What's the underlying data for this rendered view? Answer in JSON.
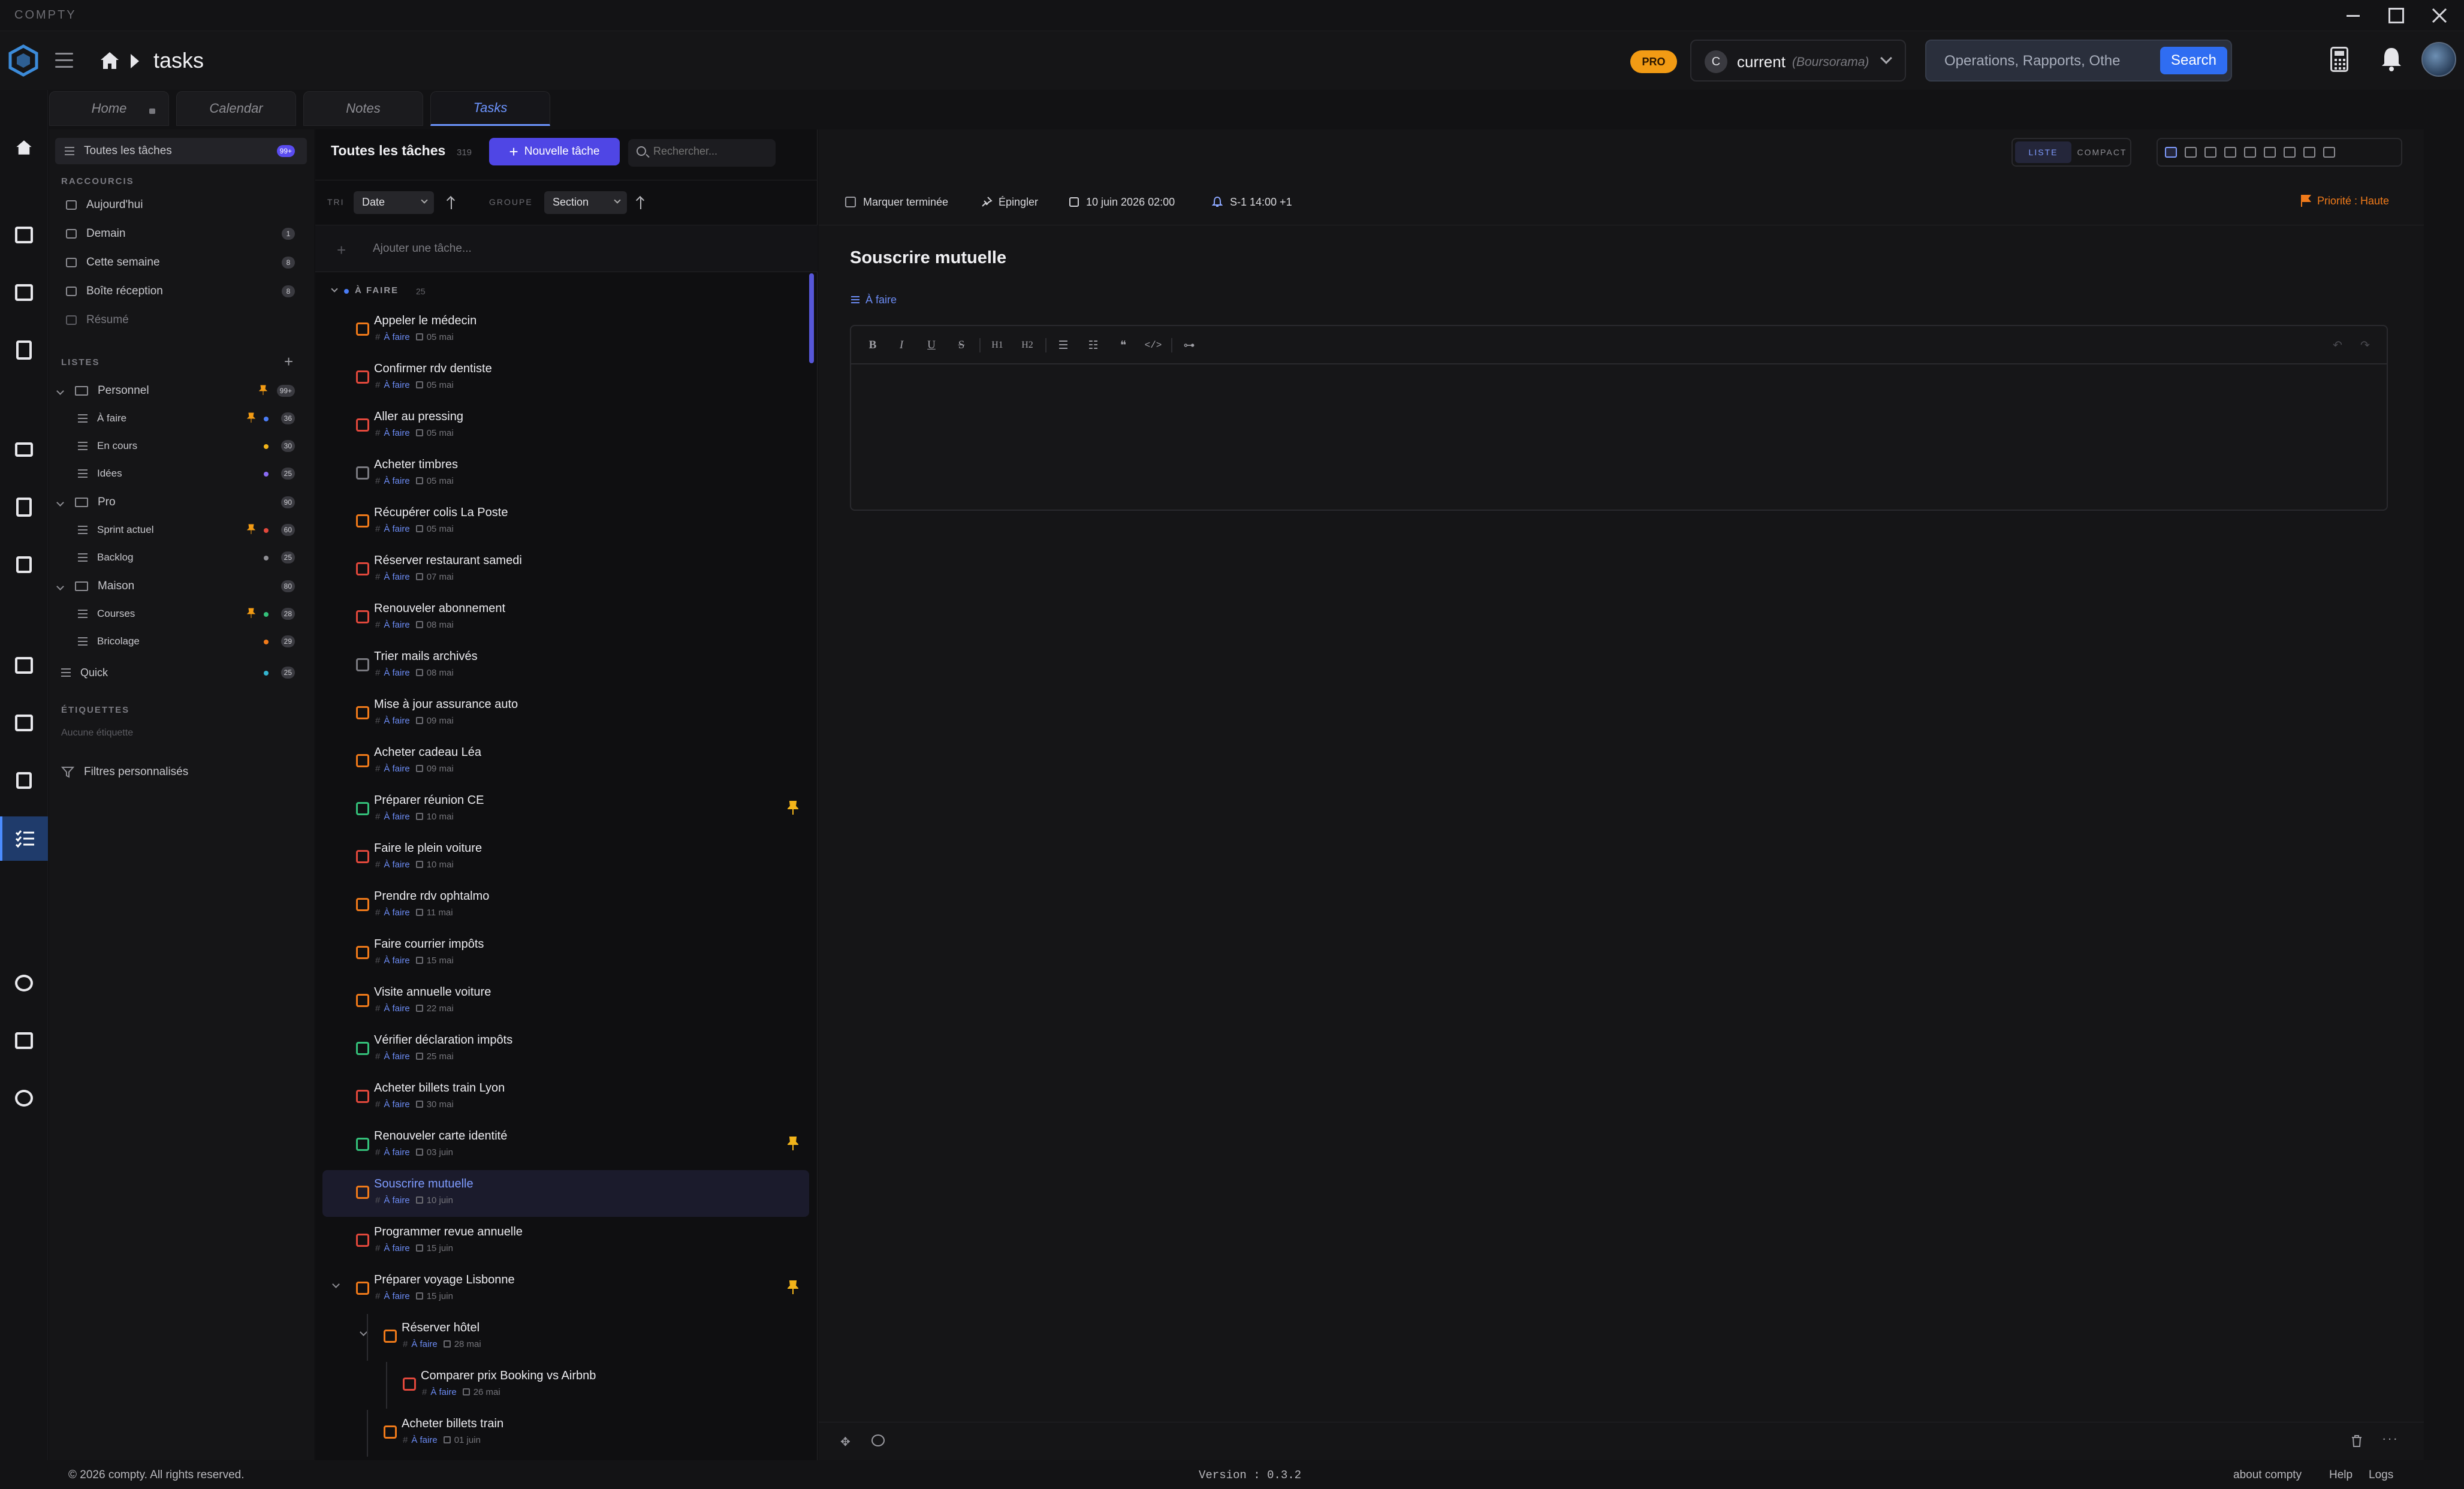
{
  "app": {
    "name": "COMPTY",
    "page_title": "tasks",
    "pro_label": "PRO"
  },
  "account": {
    "avatar_letter": "C",
    "name": "current",
    "bank": "(Boursorama)"
  },
  "search": {
    "placeholder": "Operations, Rapports, Othe",
    "button": "Search"
  },
  "tabs": [
    {
      "label": "Home"
    },
    {
      "label": "Calendar"
    },
    {
      "label": "Notes"
    },
    {
      "label": "Tasks"
    }
  ],
  "sidebar": {
    "all_tasks": {
      "label": "Toutes les tâches",
      "count": "99+"
    },
    "shortcuts_heading": "RACCOURCIS",
    "shortcuts": [
      {
        "label": "Aujourd'hui"
      },
      {
        "label": "Demain",
        "count": "1"
      },
      {
        "label": "Cette semaine",
        "count": "8"
      },
      {
        "label": "Boîte réception",
        "count": "8"
      },
      {
        "label": "Résumé"
      }
    ],
    "lists_heading": "LISTES",
    "folders": [
      {
        "label": "Personnel",
        "count": "99+",
        "lists": [
          {
            "label": "À faire",
            "count": "36"
          },
          {
            "label": "En cours",
            "count": "30"
          },
          {
            "label": "Idées",
            "count": "25"
          }
        ]
      },
      {
        "label": "Pro",
        "count": "90",
        "lists": [
          {
            "label": "Sprint actuel",
            "count": "60"
          },
          {
            "label": "Backlog",
            "count": "25"
          }
        ]
      },
      {
        "label": "Maison",
        "count": "80",
        "lists": [
          {
            "label": "Courses",
            "count": "28"
          },
          {
            "label": "Bricolage",
            "count": "29"
          }
        ]
      }
    ],
    "quick": {
      "label": "Quick",
      "count": "25"
    },
    "tags_heading": "ÉTIQUETTES",
    "no_tags": "Aucune étiquette",
    "custom_filters": "Filtres personnalisés"
  },
  "list": {
    "title": "Toutes les tâches",
    "count": "319",
    "new_button": "Nouvelle tâche",
    "search_placeholder": "Rechercher...",
    "sort_label": "TRI",
    "sort_value": "Date",
    "group_label": "GROUPE",
    "group_value": "Section",
    "add_placeholder": "Ajouter une tâche...",
    "group_heading": "À FAIRE",
    "group_count": "25",
    "tasks": [
      {
        "title": "Appeler le médecin",
        "list": "À faire",
        "date": "05 mai"
      },
      {
        "title": "Confirmer rdv dentiste",
        "list": "À faire",
        "date": "05 mai"
      },
      {
        "title": "Aller au pressing",
        "list": "À faire",
        "date": "05 mai"
      },
      {
        "title": "Acheter timbres",
        "list": "À faire",
        "date": "05 mai"
      },
      {
        "title": "Récupérer colis La Poste",
        "list": "À faire",
        "date": "05 mai"
      },
      {
        "title": "Réserver restaurant samedi",
        "list": "À faire",
        "date": "07 mai"
      },
      {
        "title": "Renouveler abonnement",
        "list": "À faire",
        "date": "08 mai"
      },
      {
        "title": "Trier mails archivés",
        "list": "À faire",
        "date": "08 mai"
      },
      {
        "title": "Mise à jour assurance auto",
        "list": "À faire",
        "date": "09 mai"
      },
      {
        "title": "Acheter cadeau Léa",
        "list": "À faire",
        "date": "09 mai"
      },
      {
        "title": "Préparer réunion CE",
        "list": "À faire",
        "date": "10 mai"
      },
      {
        "title": "Faire le plein voiture",
        "list": "À faire",
        "date": "10 mai"
      },
      {
        "title": "Prendre rdv ophtalmo",
        "list": "À faire",
        "date": "11 mai"
      },
      {
        "title": "Faire courrier impôts",
        "list": "À faire",
        "date": "15 mai"
      },
      {
        "title": "Visite annuelle voiture",
        "list": "À faire",
        "date": "22 mai"
      },
      {
        "title": "Vérifier déclaration impôts",
        "list": "À faire",
        "date": "25 mai"
      },
      {
        "title": "Acheter billets train Lyon",
        "list": "À faire",
        "date": "30 mai"
      },
      {
        "title": "Renouveler carte identité",
        "list": "À faire",
        "date": "03 juin"
      },
      {
        "title": "Souscrire mutuelle",
        "list": "À faire",
        "date": "10 juin"
      },
      {
        "title": "Programmer revue annuelle",
        "list": "À faire",
        "date": "15 juin"
      },
      {
        "title": "Préparer voyage Lisbonne",
        "list": "À faire",
        "date": "15 juin"
      },
      {
        "title": "Réserver hôtel",
        "list": "À faire",
        "date": "28 mai"
      },
      {
        "title": "Comparer prix Booking vs Airbnb",
        "list": "À faire",
        "date": "26 mai"
      },
      {
        "title": "Acheter billets train",
        "list": "À faire",
        "date": "01 juin"
      }
    ]
  },
  "detail": {
    "mark_done": "Marquer terminée",
    "pin": "Épingler",
    "due": "10 juin 2026 02:00",
    "reminder": "S-1 14:00 +1",
    "priority": "Priorité : Haute",
    "view_list": "LISTE",
    "view_compact": "COMPACT",
    "title": "Souscrire mutuelle",
    "list": "À faire",
    "editor_buttons": [
      "B",
      "I",
      "U",
      "S",
      "H1",
      "H2"
    ]
  },
  "footer": {
    "copyright": "© 2026 compty. All rights reserved.",
    "version": "Version : 0.3.2",
    "about": "about compty",
    "help": "Help",
    "logs": "Logs"
  },
  "colors": {
    "accent": "#4f46e5",
    "priority": "#f07a1a",
    "search_btn": "#2f6df2",
    "pro": "#f29b14"
  }
}
